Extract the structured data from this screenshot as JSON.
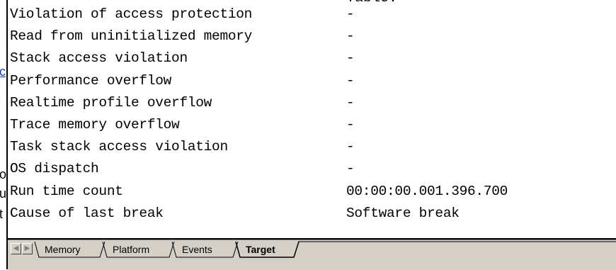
{
  "left_strip": {
    "fragments": [
      {
        "text": "c",
        "link": true
      },
      {
        "text": "o",
        "link": false
      },
      {
        "text": "u",
        "link": false
      },
      {
        "text": "t",
        "link": false
      }
    ]
  },
  "top_partial_text": "Table:",
  "table": {
    "rows": [
      {
        "name": "Violation of access protection",
        "value": "-"
      },
      {
        "name": "Read from uninitialized memory",
        "value": "-"
      },
      {
        "name": "Stack access violation",
        "value": "-"
      },
      {
        "name": "Performance overflow",
        "value": "-"
      },
      {
        "name": "Realtime profile overflow",
        "value": "-"
      },
      {
        "name": "Trace memory overflow",
        "value": "-"
      },
      {
        "name": "Task stack access violation",
        "value": "-"
      },
      {
        "name": "OS dispatch",
        "value": "-"
      },
      {
        "name": "Run time count",
        "value": "00:00:00.001.396.700"
      },
      {
        "name": "Cause of last break",
        "value": "Software break"
      }
    ]
  },
  "tabs": {
    "items": [
      {
        "label": "Memory",
        "active": false
      },
      {
        "label": "Platform",
        "active": false
      },
      {
        "label": "Events",
        "active": false
      },
      {
        "label": "Target",
        "active": true
      }
    ],
    "nav": {
      "prev_icon": "arrow-left-icon",
      "next_icon": "arrow-right-icon"
    }
  },
  "colors": {
    "face": "#d4d0c8",
    "link": "#1f3fbf",
    "text": "#000000"
  }
}
